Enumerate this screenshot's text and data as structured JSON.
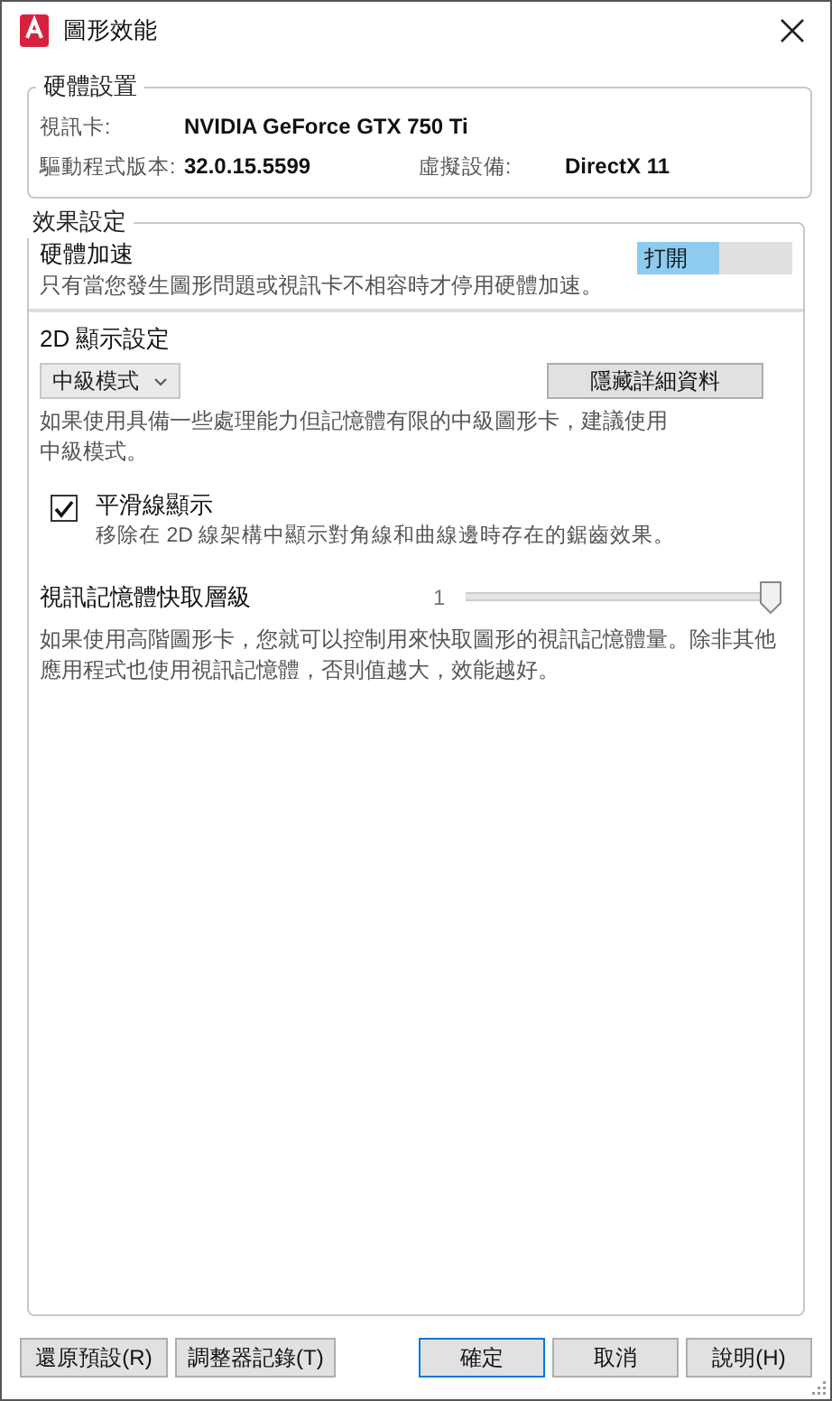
{
  "window": {
    "title": "圖形效能"
  },
  "hardware": {
    "title": "硬體設置",
    "rows": [
      {
        "label": "視訊卡:",
        "value": "NVIDIA GeForce GTX 750 Ti"
      },
      {
        "label": "驅動程式版本:",
        "value": "32.0.15.5599",
        "label2": "虛擬設備:",
        "value2": "DirectX 11"
      }
    ]
  },
  "effects": {
    "title": "效果設定",
    "acceleration": {
      "label": "硬體加速",
      "description": "只有當您發生圖形問題或視訊卡不相容時才停用硬體加速。",
      "toggle": {
        "label": "打開",
        "on": true
      }
    },
    "display_2d": {
      "label": "2D 顯示設定",
      "dropdown": {
        "value": "中級模式"
      },
      "details_button": "隱藏詳細資料",
      "description": "如果使用具備一些處理能力但記憶體有限的中級圖形卡，建議使用中級模式。"
    },
    "smooth_line": {
      "label": "平滑線顯示",
      "checked": true,
      "description": "移除在 2D 線架構中顯示對角線和曲線邊時存在的鋸齒效果。"
    },
    "cache": {
      "label": "視訊記憶體快取層級",
      "reading": "1",
      "level": 1,
      "description": "如果使用高階圖形卡，您就可以控制用來快取圖形的視訊記憶體量。除非其他應用程式也使用視訊記憶體，否則值越大，效能越好。"
    }
  },
  "buttons": [
    {
      "label": "還原預設(R)",
      "default": false
    },
    {
      "label": "調整器記錄(T)",
      "default": false
    },
    {
      "label": "確定",
      "default": true
    },
    {
      "label": "取消",
      "default": false
    },
    {
      "label": "說明(H)",
      "default": false
    }
  ]
}
